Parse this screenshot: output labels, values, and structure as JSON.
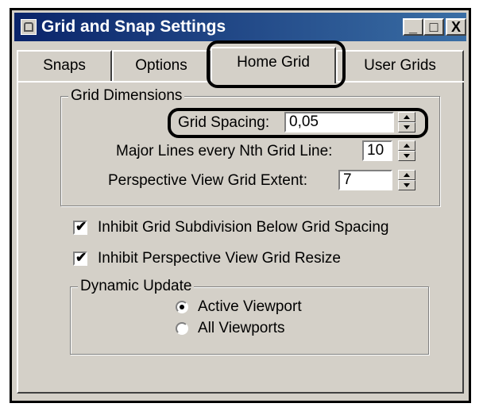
{
  "window": {
    "title": "Grid and Snap Settings",
    "icon": "app-icon"
  },
  "caption_buttons": {
    "minimize": "_",
    "maximize": "□",
    "close": "X"
  },
  "tabs": [
    {
      "label": "Snaps",
      "active": false
    },
    {
      "label": "Options",
      "active": false
    },
    {
      "label": "Home Grid",
      "active": true
    },
    {
      "label": "User Grids",
      "active": false
    }
  ],
  "grid_dimensions": {
    "group_label": "Grid Dimensions",
    "grid_spacing": {
      "label": "Grid Spacing:",
      "value": "0,05"
    },
    "major_lines": {
      "label": "Major Lines every Nth Grid Line:",
      "value": "10"
    },
    "perspective_extent": {
      "label": "Perspective View Grid Extent:",
      "value": "7"
    }
  },
  "options": {
    "inhibit_subdivision": {
      "label": "Inhibit Grid Subdivision Below Grid Spacing",
      "checked": true
    },
    "inhibit_perspective": {
      "label": "Inhibit Perspective View Grid Resize",
      "checked": true
    }
  },
  "dynamic_update": {
    "group_label": "Dynamic Update",
    "options": [
      {
        "label": "Active Viewport",
        "selected": true
      },
      {
        "label": "All Viewports",
        "selected": false
      }
    ]
  },
  "colors": {
    "titlebar_start": "#0a246a",
    "titlebar_end": "#3a6ea5",
    "dialog_bg": "#d4d0c8"
  }
}
